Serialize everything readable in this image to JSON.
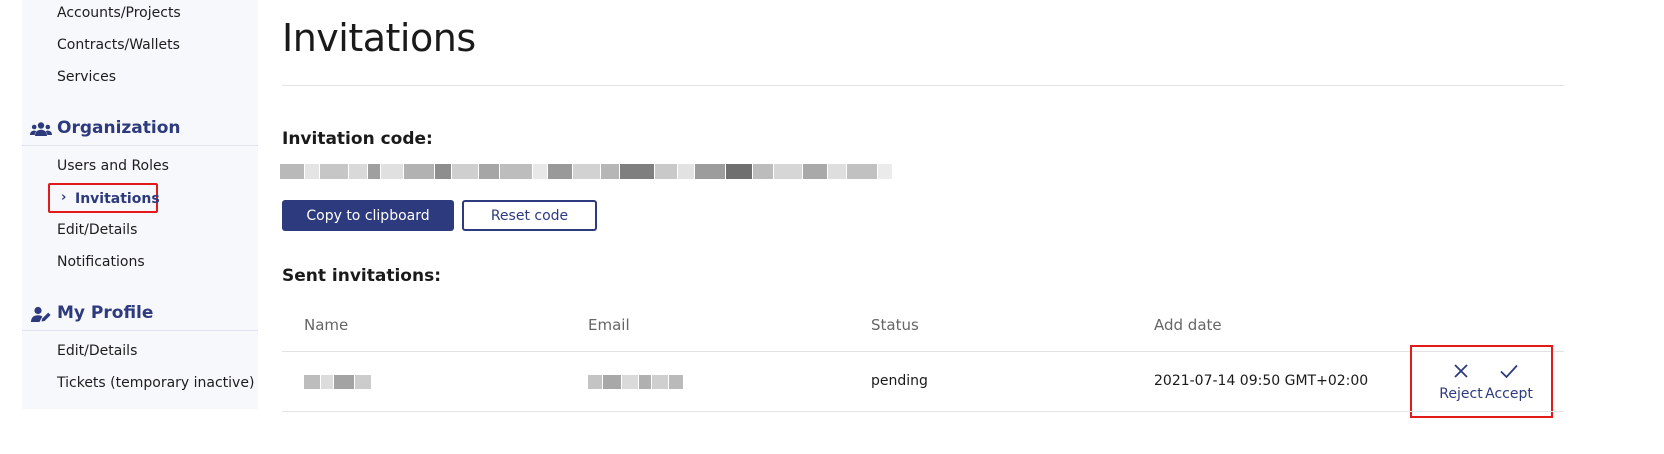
{
  "sidebar": {
    "top_items": [
      {
        "label": "Accounts/Projects"
      },
      {
        "label": "Contracts/Wallets"
      },
      {
        "label": "Services"
      }
    ],
    "organization": {
      "title": "Organization",
      "icon": "users-icon",
      "items": [
        {
          "label": "Users and Roles"
        },
        {
          "label": "Invitations",
          "active": true
        },
        {
          "label": "Edit/Details"
        },
        {
          "label": "Notifications"
        }
      ]
    },
    "profile": {
      "title": "My Profile",
      "icon": "user-edit-icon",
      "items": [
        {
          "label": "Edit/Details"
        },
        {
          "label": "Tickets (temporary inactive)"
        }
      ]
    },
    "active_chevron": "›"
  },
  "main": {
    "title": "Invitations",
    "invitation_code_label": "Invitation code:",
    "copy_button": "Copy to clipboard",
    "reset_button": "Reset code",
    "sent_invitations_label": "Sent invitations:",
    "table": {
      "columns": [
        "Name",
        "Email",
        "Status",
        "Add date"
      ],
      "rows": [
        {
          "name": "",
          "email": "",
          "status": "pending",
          "add_date": "2021-07-14 09:50 GMT+02:00"
        }
      ],
      "actions": {
        "reject": "Reject",
        "accept": "Accept"
      }
    }
  },
  "colors": {
    "accent": "#2d3a7d",
    "highlight": "#e21a1a",
    "sidebar_bg": "#f7f8fb"
  }
}
